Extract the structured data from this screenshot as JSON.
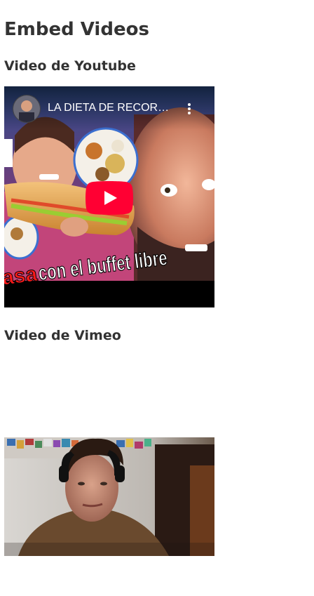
{
  "page": {
    "title": "Embed Videos"
  },
  "youtube": {
    "heading": "Video de Youtube",
    "video_title": "LA DIETA DE RECORD...",
    "caption_red": "asa",
    "caption_white": "con el buffet libre",
    "play_icon": "youtube-play-icon",
    "menu_icon": "more-vertical-icon",
    "brand_color": "#ff0033"
  },
  "vimeo": {
    "heading": "Video de Vimeo"
  }
}
